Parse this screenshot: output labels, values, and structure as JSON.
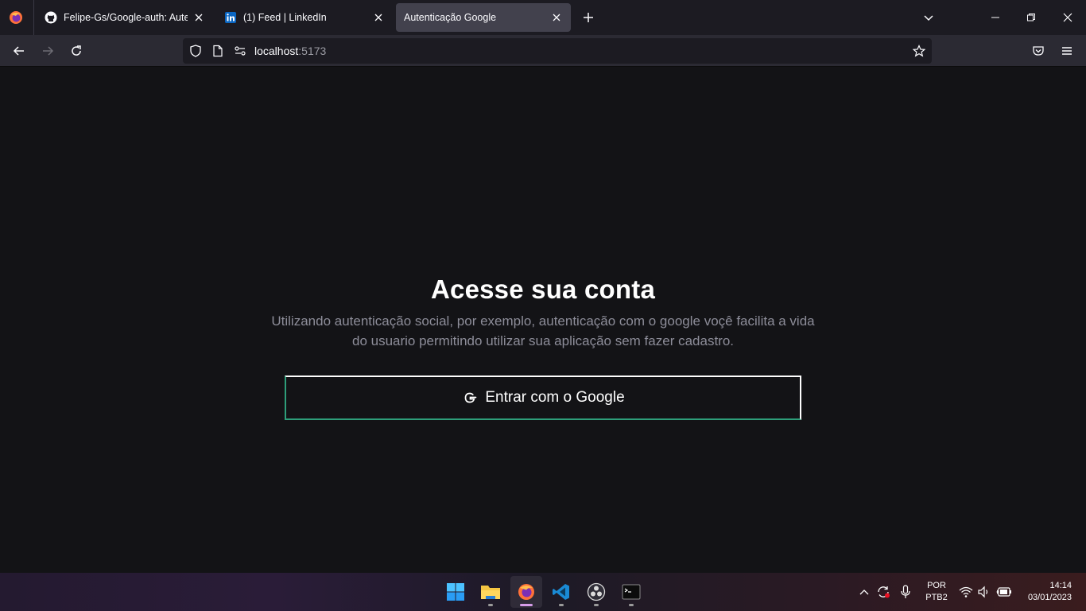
{
  "browser": {
    "tabs": [
      {
        "title": "Felipe-Gs/Google-auth: Autenti",
        "favicon": "github-icon",
        "active": false
      },
      {
        "title": "(1) Feed | LinkedIn",
        "favicon": "linkedin-icon",
        "active": false
      },
      {
        "title": "Autenticação Google",
        "favicon": "",
        "active": true
      }
    ],
    "url": {
      "host": "localhost",
      "port": ":5173"
    }
  },
  "page": {
    "heading": "Acesse sua conta",
    "description": "Utilizando autenticação social, por exemplo, autenticação com o google voçê facilita a vida do usuario permitindo utilizar sua aplicação sem fazer cadastro.",
    "google_button_label": "Entrar com o Google"
  },
  "taskbar": {
    "apps": [
      "windows-start-icon",
      "file-explorer-icon",
      "firefox-icon",
      "vscode-icon",
      "obs-icon",
      "terminal-icon"
    ],
    "language": {
      "line1": "POR",
      "line2": "PTB2"
    },
    "clock": {
      "time": "14:14",
      "date": "03/01/2023"
    }
  },
  "colors": {
    "page_bg": "#131316",
    "button_border": "#ffffff",
    "button_accent_border": "#2e9e7a",
    "description_text": "#8d8d99"
  }
}
